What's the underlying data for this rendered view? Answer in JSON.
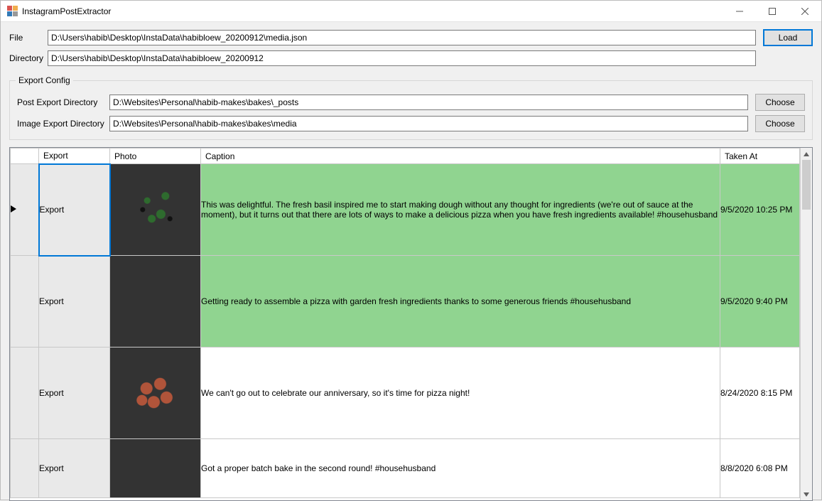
{
  "window": {
    "title": "InstagramPostExtractor"
  },
  "form": {
    "file_label": "File",
    "file_value": "D:\\Users\\habib\\Desktop\\InstaData\\habibloew_20200912\\media.json",
    "dir_label": "Directory",
    "dir_value": "D:\\Users\\habib\\Desktop\\InstaData\\habibloew_20200912",
    "load_label": "Load"
  },
  "export": {
    "legend": "Export Config",
    "post_dir_label": "Post Export Directory",
    "post_dir_value": "D:\\Websites\\Personal\\habib-makes\\bakes\\_posts",
    "image_dir_label": "Image Export Directory",
    "image_dir_value": "D:\\Websites\\Personal\\habib-makes\\bakes\\media",
    "choose_label": "Choose"
  },
  "grid": {
    "headers": {
      "export": "Export",
      "photo": "Photo",
      "caption": "Caption",
      "taken_at": "Taken At"
    },
    "rows": [
      {
        "export_label": "Export",
        "caption": "This was delightful. The fresh basil inspired me to start making dough without any thought for ingredients (we're out of sauce at the moment), but it turns out that there are lots of ways to make a delicious pizza when you have fresh ingredients available! #househusband",
        "taken_at": "9/5/2020 10:25 PM",
        "highlight": true,
        "selected": true
      },
      {
        "export_label": "Export",
        "caption": "Getting ready to assemble a pizza with garden fresh ingredients thanks to some generous friends #househusband",
        "taken_at": "9/5/2020 9:40 PM",
        "highlight": true,
        "selected": false
      },
      {
        "export_label": "Export",
        "caption": "We can't go out to celebrate our anniversary, so it's time for pizza night!",
        "taken_at": "8/24/2020 8:15 PM",
        "highlight": false,
        "selected": false
      },
      {
        "export_label": "Export",
        "caption": "Got a proper batch bake in the second round! #househusband",
        "taken_at": "8/8/2020 6:08 PM",
        "highlight": false,
        "selected": false
      }
    ]
  }
}
